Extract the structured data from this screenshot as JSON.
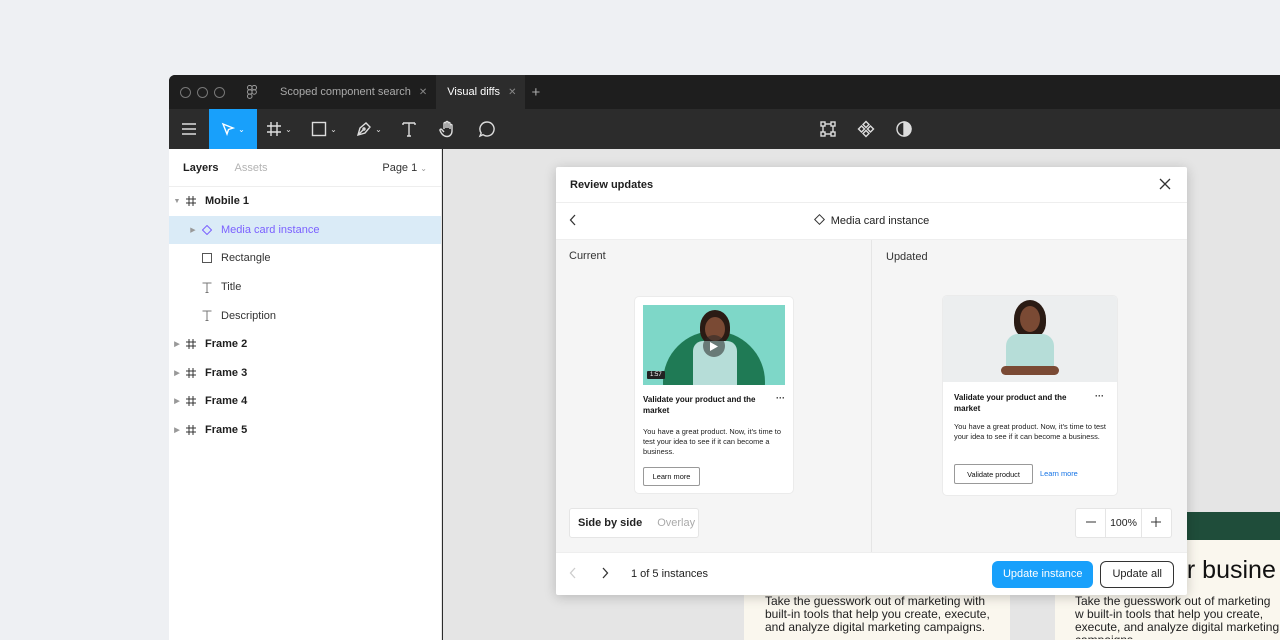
{
  "tabs": [
    {
      "label": "Scoped component search",
      "active": false
    },
    {
      "label": "Visual diffs",
      "active": true
    }
  ],
  "toolbar": {
    "colors": {
      "accent": "#18a0fb"
    }
  },
  "sidebar": {
    "tabs": [
      "Layers",
      "Assets"
    ],
    "page": "Page 1",
    "layers": [
      {
        "label": "Mobile 1"
      },
      {
        "label": "Media card instance"
      },
      {
        "label": "Rectangle"
      },
      {
        "label": "Title"
      },
      {
        "label": "Description"
      },
      {
        "label": "Frame 2"
      },
      {
        "label": "Frame 3"
      },
      {
        "label": "Frame 4"
      },
      {
        "label": "Frame 5"
      }
    ]
  },
  "modal": {
    "title": "Review updates",
    "component": "Media card instance",
    "current_label": "Current",
    "updated_label": "Updated",
    "current_card": {
      "duration": "1:57",
      "title": "Validate your product and the market",
      "description": "You have a great product. Now, it's time to test your idea to see if it can become a business.",
      "button": "Learn more"
    },
    "updated_card": {
      "title": "Validate your product and the market",
      "description": "You have a great product. Now, it's time to test your idea to see if it can become a business.",
      "button": "Validate product",
      "link": "Learn more"
    },
    "view_modes": [
      "Side by side",
      "Overlay"
    ],
    "zoom": "100%",
    "count": "1 of 5 instances",
    "primary": "Update instance",
    "secondary": "Update all"
  },
  "canvas_bg": {
    "heading_fragment": "ur busine",
    "body_text": "Take the guesswork out of marketing with built-in tools that help you create, execute, and analyze digital marketing campaigns.",
    "body_text_2": "Take the guesswork out of marketing w built-in tools that help you create, execute, and analyze digital marketing campaigns"
  }
}
